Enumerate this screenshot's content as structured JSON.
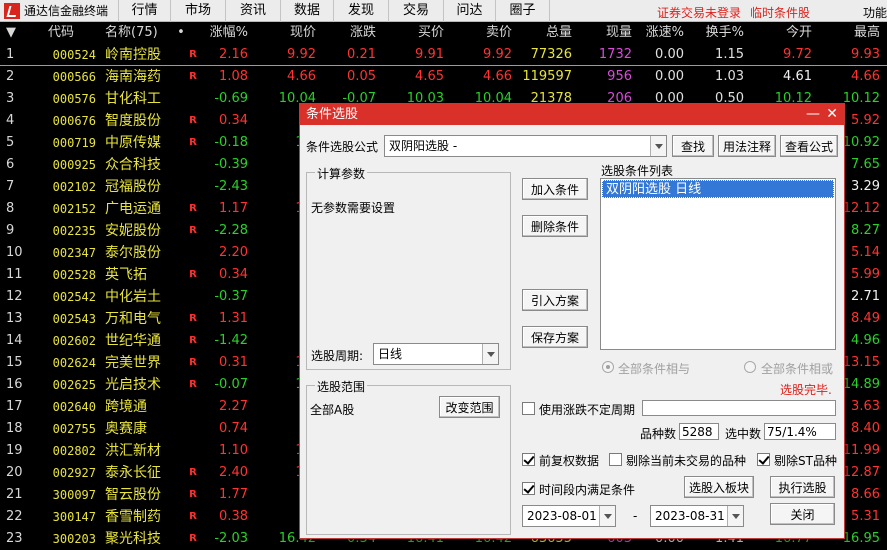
{
  "app": {
    "title": "通达信金融终端",
    "menu": [
      "行情",
      "市场",
      "资讯",
      "数据",
      "发现",
      "交易",
      "问达",
      "圈子"
    ],
    "status": "证券交易未登录",
    "cond_label": "临时条件股",
    "func_label": "功能"
  },
  "table": {
    "headers": {
      "idx": "▼",
      "code": "代码",
      "name": "名称(75)",
      "star": "•",
      "pct": "涨幅%",
      "price": "现价",
      "chg": "涨跌",
      "buy": "买价",
      "sell": "卖价",
      "vol": "总量",
      "cur": "现量",
      "spd": "涨速%",
      "turn": "换手%",
      "open": "今开",
      "high": "最高"
    },
    "rows": [
      {
        "idx": "1",
        "code": "000524",
        "name": "岭南控股",
        "r": "R",
        "pct": "2.16",
        "price": "9.92",
        "chg": "0.21",
        "buy": "9.91",
        "sell": "9.92",
        "vol": "77326",
        "cur": "1732",
        "spd": "0.00",
        "turn": "1.15",
        "open": "9.72",
        "high": "9.93"
      },
      {
        "idx": "2",
        "code": "000566",
        "name": "海南海药",
        "r": "R",
        "pct": "1.08",
        "price": "4.66",
        "chg": "0.05",
        "buy": "4.65",
        "sell": "4.66",
        "vol": "119597",
        "cur": "956",
        "spd": "0.00",
        "turn": "1.03",
        "open": "4.61",
        "high": "4.66"
      },
      {
        "idx": "3",
        "code": "000576",
        "name": "甘化科工",
        "r": "",
        "pct": "-0.69",
        "price": "10.04",
        "chg": "-0.07",
        "buy": "10.03",
        "sell": "10.04",
        "vol": "21378",
        "cur": "206",
        "spd": "0.00",
        "turn": "0.50",
        "open": "10.12",
        "high": "10.12"
      },
      {
        "idx": "4",
        "code": "000676",
        "name": "智度股份",
        "r": "R",
        "pct": "0.34",
        "price": "5.",
        "chg": "",
        "buy": "",
        "sell": "",
        "vol": "",
        "cur": "",
        "spd": "",
        "turn": "",
        "open": "",
        "high": "5.92"
      },
      {
        "idx": "5",
        "code": "000719",
        "name": "中原传媒",
        "r": "R",
        "pct": "-0.18",
        "price": "10.",
        "chg": "",
        "buy": "",
        "sell": "",
        "vol": "",
        "cur": "",
        "spd": "",
        "turn": "",
        "open": "",
        "high": "10.92"
      },
      {
        "idx": "6",
        "code": "000925",
        "name": "众合科技",
        "r": "",
        "pct": "-0.39",
        "price": "7.",
        "chg": "",
        "buy": "",
        "sell": "",
        "vol": "",
        "cur": "",
        "spd": "",
        "turn": "",
        "open": "",
        "high": "7.65"
      },
      {
        "idx": "7",
        "code": "002102",
        "name": "冠福股份",
        "r": "",
        "pct": "-2.43",
        "price": "3.",
        "chg": "",
        "buy": "",
        "sell": "",
        "vol": "",
        "cur": "",
        "spd": "",
        "turn": "",
        "open": "",
        "high": "3.29"
      },
      {
        "idx": "8",
        "code": "002152",
        "name": "广电运通",
        "r": "R",
        "pct": "1.17",
        "price": "12.",
        "chg": "",
        "buy": "",
        "sell": "",
        "vol": "",
        "cur": "",
        "spd": "",
        "turn": "",
        "open": "",
        "high": "12.12"
      },
      {
        "idx": "9",
        "code": "002235",
        "name": "安妮股份",
        "r": "R",
        "pct": "-2.28",
        "price": "8.",
        "chg": "",
        "buy": "",
        "sell": "",
        "vol": "",
        "cur": "",
        "spd": "",
        "turn": "",
        "open": "",
        "high": "8.27"
      },
      {
        "idx": "10",
        "code": "002347",
        "name": "泰尔股份",
        "r": "",
        "pct": "2.20",
        "price": "5.",
        "chg": "",
        "buy": "",
        "sell": "",
        "vol": "",
        "cur": "",
        "spd": "",
        "turn": "",
        "open": "",
        "high": "5.14"
      },
      {
        "idx": "11",
        "code": "002528",
        "name": "英飞拓",
        "r": "R",
        "pct": "0.34",
        "price": "5.",
        "chg": "",
        "buy": "",
        "sell": "",
        "vol": "",
        "cur": "",
        "spd": "",
        "turn": "",
        "open": "",
        "high": "5.99"
      },
      {
        "idx": "12",
        "code": "002542",
        "name": "中化岩土",
        "r": "",
        "pct": "-0.37",
        "price": "2.",
        "chg": "",
        "buy": "",
        "sell": "",
        "vol": "",
        "cur": "",
        "spd": "",
        "turn": "",
        "open": "",
        "high": "2.71"
      },
      {
        "idx": "13",
        "code": "002543",
        "name": "万和电气",
        "r": "R",
        "pct": "1.31",
        "price": "8.",
        "chg": "",
        "buy": "",
        "sell": "",
        "vol": "",
        "cur": "",
        "spd": "",
        "turn": "",
        "open": "",
        "high": "8.49"
      },
      {
        "idx": "14",
        "code": "002602",
        "name": "世纪华通",
        "r": "R",
        "pct": "-1.42",
        "price": "4.",
        "chg": "",
        "buy": "",
        "sell": "",
        "vol": "",
        "cur": "",
        "spd": "",
        "turn": "",
        "open": "",
        "high": "4.96"
      },
      {
        "idx": "15",
        "code": "002624",
        "name": "完美世界",
        "r": "R",
        "pct": "0.31",
        "price": "13.",
        "chg": "",
        "buy": "",
        "sell": "",
        "vol": "",
        "cur": "",
        "spd": "",
        "turn": "",
        "open": "",
        "high": "13.15"
      },
      {
        "idx": "16",
        "code": "002625",
        "name": "光启技术",
        "r": "R",
        "pct": "-0.07",
        "price": "14.",
        "chg": "",
        "buy": "",
        "sell": "",
        "vol": "",
        "cur": "",
        "spd": "",
        "turn": "",
        "open": "",
        "high": "14.89"
      },
      {
        "idx": "17",
        "code": "002640",
        "name": "跨境通",
        "r": "",
        "pct": "2.27",
        "price": "3.",
        "chg": "",
        "buy": "",
        "sell": "",
        "vol": "",
        "cur": "",
        "spd": "",
        "turn": "",
        "open": "",
        "high": "3.63"
      },
      {
        "idx": "18",
        "code": "002755",
        "name": "奥赛康",
        "r": "",
        "pct": "0.74",
        "price": "8.",
        "chg": "",
        "buy": "",
        "sell": "",
        "vol": "",
        "cur": "",
        "spd": "",
        "turn": "",
        "open": "",
        "high": "8.40"
      },
      {
        "idx": "19",
        "code": "002802",
        "name": "洪汇新材",
        "r": "",
        "pct": "1.10",
        "price": "11.",
        "chg": "",
        "buy": "",
        "sell": "",
        "vol": "",
        "cur": "",
        "spd": "",
        "turn": "",
        "open": "",
        "high": "11.99"
      },
      {
        "idx": "20",
        "code": "002927",
        "name": "泰永长征",
        "r": "R",
        "pct": "2.40",
        "price": "12.",
        "chg": "",
        "buy": "",
        "sell": "",
        "vol": "",
        "cur": "",
        "spd": "",
        "turn": "",
        "open": "",
        "high": "12.87"
      },
      {
        "idx": "21",
        "code": "300097",
        "name": "智云股份",
        "r": "R",
        "pct": "1.77",
        "price": "8.",
        "chg": "",
        "buy": "",
        "sell": "",
        "vol": "",
        "cur": "",
        "spd": "",
        "turn": "",
        "open": "",
        "high": "8.66"
      },
      {
        "idx": "22",
        "code": "300147",
        "name": "香雪制药",
        "r": "R",
        "pct": "0.38",
        "price": "5.",
        "chg": "",
        "buy": "",
        "sell": "",
        "vol": "",
        "cur": "",
        "spd": "",
        "turn": "",
        "open": "",
        "high": "5.31"
      },
      {
        "idx": "23",
        "code": "300203",
        "name": "聚光科技",
        "r": "R",
        "pct": "-2.03",
        "price": "16.42",
        "chg": "-0.34",
        "buy": "16.41",
        "sell": "16.42",
        "vol": "63655",
        "cur": "603",
        "spd": "0.00",
        "turn": "1.41",
        "open": "16.77",
        "high": "16.95"
      }
    ]
  },
  "dialog": {
    "title": "条件选股",
    "formula_label": "条件选股公式",
    "formula_value": "双阴阳选股  -",
    "find_btn": "查找",
    "usage_btn": "用法注释",
    "view_btn": "查看公式",
    "params_group": "计算参数",
    "params_text": "无参数需要设置",
    "period_label": "选股周期:",
    "period_value": "日线",
    "add_btn": "加入条件",
    "delete_btn": "删除条件",
    "import_btn": "引入方案",
    "save_btn": "保存方案",
    "cond_list_label": "选股条件列表",
    "cond_items": [
      "双阴阳选股  日线"
    ],
    "radio_and": "全部条件相与",
    "radio_or": "全部条件相或",
    "scope_group": "选股范围",
    "scope_value": "全部A股",
    "change_scope_btn": "改变范围",
    "done_text": "选股完毕.",
    "use_uncertain": "使用涨跌不定周期",
    "total_label": "品种数",
    "total_value": "5288",
    "selected_label": "选中数",
    "selected_value": "75/1.4%",
    "fq_label": "前复权数据",
    "exclude_untraded": "剔除当前未交易的品种",
    "exclude_st": "剔除ST品种",
    "time_range": "时间段内满足条件",
    "select_to_block_btn": "选股入板块",
    "execute_btn": "执行选股",
    "date_start": "2023-08-01",
    "date_sep": "-",
    "date_end": "2023-08-31",
    "close_btn": "关闭"
  },
  "colors": {
    "up": "#ff3333",
    "down": "#2ad12a",
    "code": "#e8e43a",
    "dialog_title": "#d9302a"
  }
}
